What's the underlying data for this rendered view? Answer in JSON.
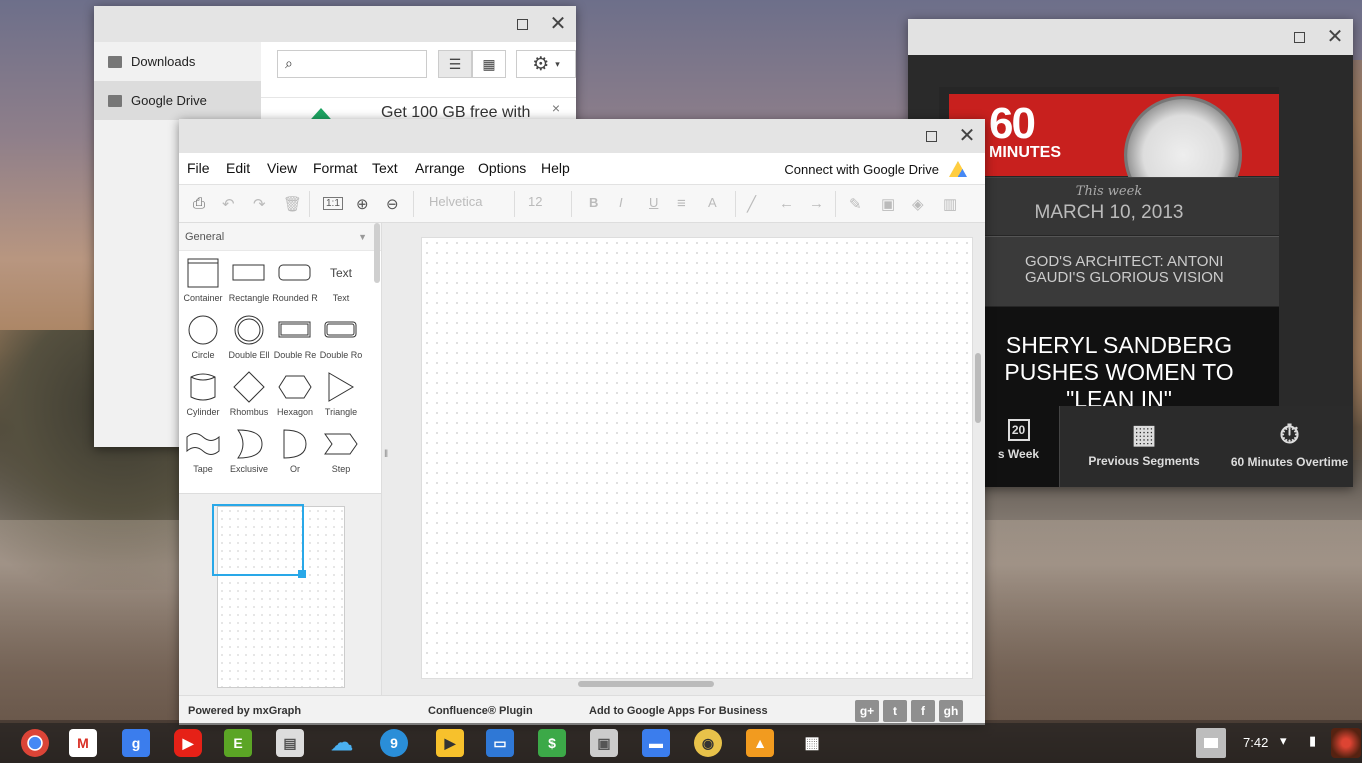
{
  "files": {
    "sidebar": [
      {
        "label": "Downloads"
      },
      {
        "label": "Google Drive"
      }
    ],
    "promo": "Get 100 GB free with",
    "promo_close": "×"
  },
  "tv": {
    "logo": "60",
    "logo_sub": "MINUTES",
    "week_label": "This week",
    "week_date": "MARCH 10, 2013",
    "segment": "GOD'S ARCHITECT: ANTONI GAUDI'S GLORIOUS VISION",
    "feature": "SHERYL SANDBERG PUSHES WOMEN TO \"LEAN IN\"",
    "nav": [
      {
        "label": "s Week",
        "icon_text": "20"
      },
      {
        "label": "Previous Segments"
      },
      {
        "label": "60 Minutes Overtime"
      }
    ]
  },
  "draw": {
    "menu": [
      "File",
      "Edit",
      "View",
      "Format",
      "Text",
      "Arrange",
      "Options",
      "Help"
    ],
    "connect": "Connect with Google Drive",
    "font_name": "Helvetica",
    "font_size": "12",
    "zoom_actual": "1:1",
    "palette_title": "General",
    "shapes": [
      {
        "label": "Container"
      },
      {
        "label": "Rectangle"
      },
      {
        "label": "Rounded R"
      },
      {
        "label": "Text",
        "preview": "Text"
      },
      {
        "label": "Circle"
      },
      {
        "label": "Double Ell"
      },
      {
        "label": "Double Re"
      },
      {
        "label": "Double Ro"
      },
      {
        "label": "Cylinder"
      },
      {
        "label": "Rhombus"
      },
      {
        "label": "Hexagon"
      },
      {
        "label": "Triangle"
      },
      {
        "label": "Tape"
      },
      {
        "label": "Exclusive"
      },
      {
        "label": "Or"
      },
      {
        "label": "Step"
      }
    ],
    "footer": {
      "powered": "Powered by mxGraph",
      "confluence": "Confluence® Plugin",
      "apps": "Add to Google Apps For Business"
    },
    "social": [
      "g+",
      "t",
      "f",
      "gh"
    ]
  },
  "shelf": {
    "time": "7:42",
    "apps": [
      "chrome",
      "gmail",
      "google-search",
      "youtube",
      "evernote",
      "web-store",
      "cloud",
      "9",
      "hangouts",
      "files",
      "cash",
      "drive-image",
      "folder",
      "eye",
      "slides",
      "launcher"
    ]
  },
  "colors": {
    "tv_red": "#c8201e",
    "selection_blue": "#29a8e8"
  }
}
